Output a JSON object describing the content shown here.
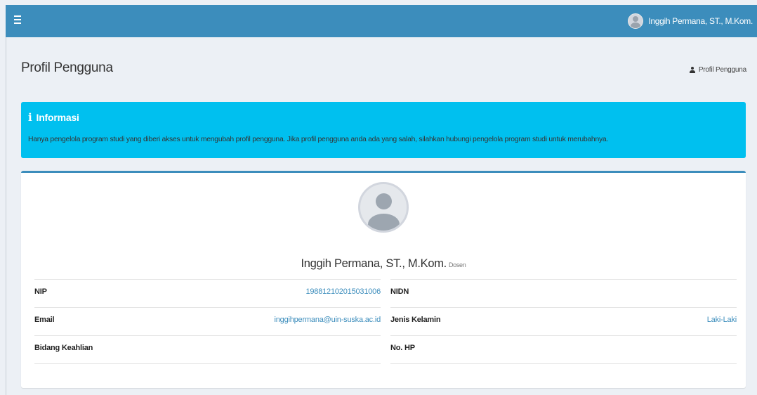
{
  "header": {
    "user_name": "Inggih Permana, ST., M.Kom."
  },
  "page": {
    "title": "Profil Pengguna",
    "breadcrumb": "Profil Pengguna"
  },
  "callout": {
    "title": "Informasi",
    "text": "Hanya pengelola program studi yang diberi akses untuk mengubah profil pengguna. Jika profil pengguna anda ada yang salah, silahkan hubungi pengelola program studi untuk merubahnya."
  },
  "profile": {
    "name": "Inggih Permana, ST., M.Kom.",
    "role": "Dosen",
    "left": [
      {
        "label": "NIP",
        "value": "198812102015031006"
      },
      {
        "label": "Email",
        "value": "inggihpermana@uin-suska.ac.id"
      },
      {
        "label": "Bidang Keahlian",
        "value": ""
      }
    ],
    "right": [
      {
        "label": "NIDN",
        "value": ""
      },
      {
        "label": "Jenis Kelamin",
        "value": "Laki-Laki"
      },
      {
        "label": "No. HP",
        "value": ""
      }
    ]
  },
  "colors": {
    "topbar": "#3c8dbc",
    "callout": "#00c0ef",
    "link": "#3c8dbc"
  }
}
